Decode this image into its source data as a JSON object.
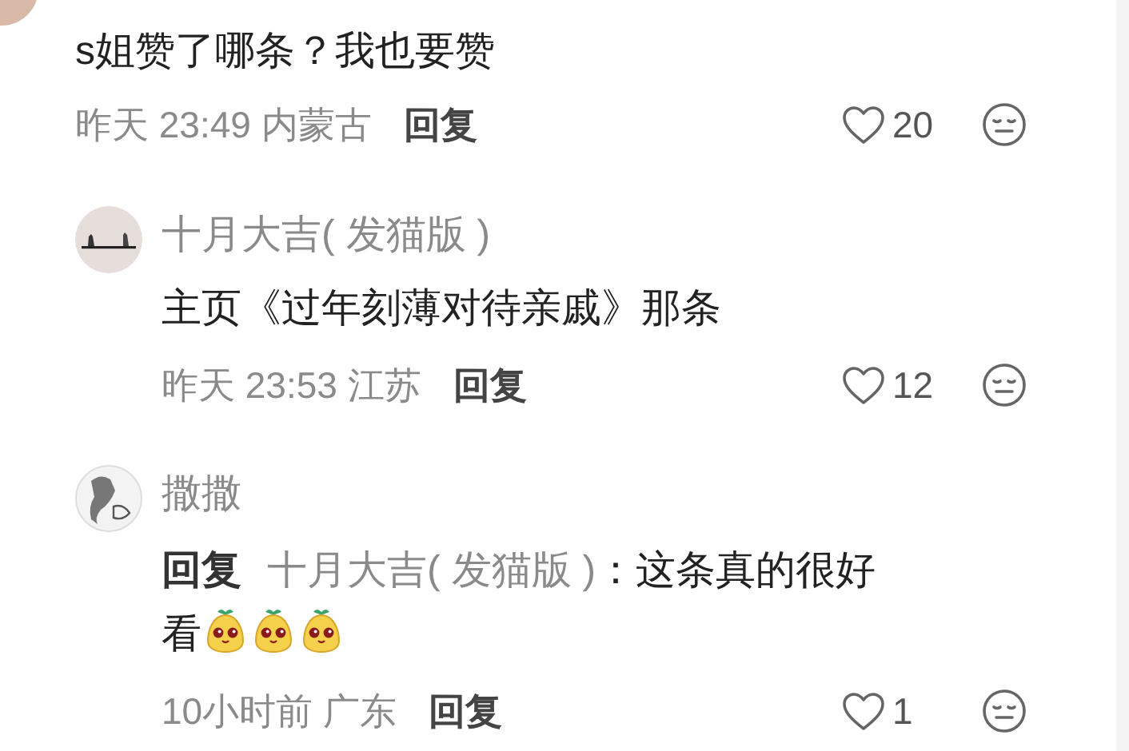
{
  "comment": {
    "text": "s姐赞了哪条？我也要赞",
    "time": "昨天 23:49",
    "location": "内蒙古",
    "reply_label": "回复",
    "likes": "20",
    "liked": false
  },
  "replies": [
    {
      "author": "十月大吉( 发猫版 )",
      "avatar": {
        "kind": "cats"
      },
      "text": "主页《过年刻薄对待亲戚》那条",
      "time": "昨天 23:53",
      "location": "江苏",
      "reply_label": "回复",
      "likes": "12",
      "liked": false
    },
    {
      "author": "撒撒",
      "avatar": {
        "kind": "sketch"
      },
      "reply_prefix": "回复",
      "reply_to": "十月大吉( 发猫版 )",
      "text": "：这条真的很好看",
      "emojis": [
        {
          "kind": "fruit-face"
        },
        {
          "kind": "fruit-face"
        },
        {
          "kind": "fruit-face"
        }
      ],
      "time": "10小时前",
      "location": "广东",
      "reply_label": "回复",
      "likes": "1",
      "liked": false
    }
  ]
}
